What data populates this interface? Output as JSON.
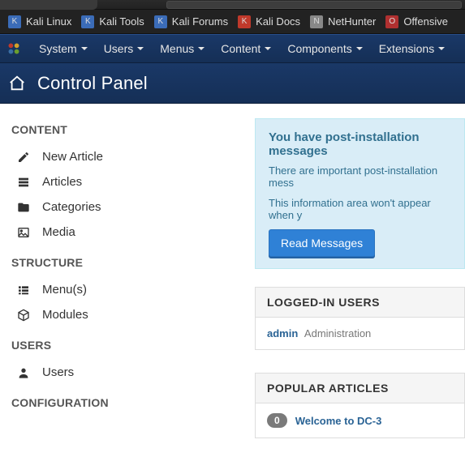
{
  "bookmarks": {
    "items": [
      {
        "label": "Kali Linux"
      },
      {
        "label": "Kali Tools"
      },
      {
        "label": "Kali Forums"
      },
      {
        "label": "Kali Docs"
      },
      {
        "label": "NetHunter"
      },
      {
        "label": "Offensive"
      }
    ]
  },
  "menu": {
    "items": [
      {
        "label": "System"
      },
      {
        "label": "Users"
      },
      {
        "label": "Menus"
      },
      {
        "label": "Content"
      },
      {
        "label": "Components"
      },
      {
        "label": "Extensions"
      }
    ]
  },
  "title": "Control Panel",
  "sidebar": {
    "sections": [
      {
        "heading": "CONTENT",
        "items": [
          {
            "label": "New Article"
          },
          {
            "label": "Articles"
          },
          {
            "label": "Categories"
          },
          {
            "label": "Media"
          }
        ]
      },
      {
        "heading": "STRUCTURE",
        "items": [
          {
            "label": "Menu(s)"
          },
          {
            "label": "Modules"
          }
        ]
      },
      {
        "heading": "USERS",
        "items": [
          {
            "label": "Users"
          }
        ]
      },
      {
        "heading": "CONFIGURATION",
        "items": []
      }
    ]
  },
  "alert": {
    "title": "You have post-installation messages",
    "line1": "There are important post-installation mess",
    "line2": "This information area won't appear when y",
    "button": "Read Messages"
  },
  "panel_logged": {
    "heading": "LOGGED-IN USERS",
    "user": "admin",
    "area": "Administration"
  },
  "panel_popular": {
    "heading": "POPULAR ARTICLES",
    "count": "0",
    "article": "Welcome to DC-3"
  }
}
